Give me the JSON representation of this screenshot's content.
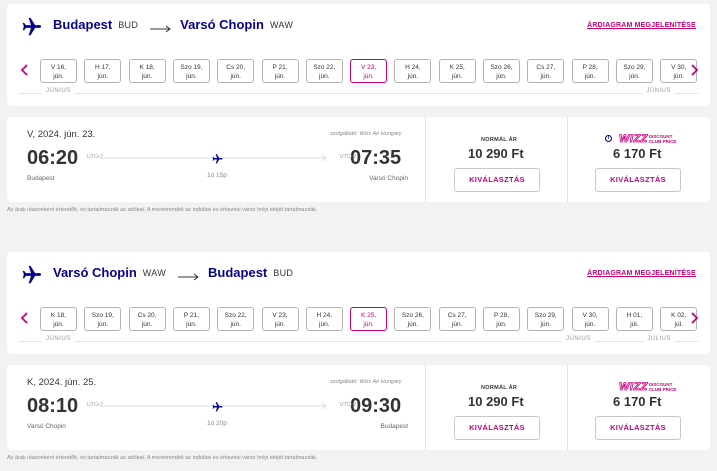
{
  "colors": {
    "brand": "#06038d",
    "accent": "#c6007e",
    "background": "#f2f2f2"
  },
  "sections": [
    {
      "route": {
        "from": "Budapest",
        "from_code": "BUD",
        "to": "Varsó Chopin",
        "to_code": "WAW"
      },
      "price_diagram": "ÁRDIAGRAM MEGJELENÍTÉSE",
      "dates": [
        {
          "day": "V 16,",
          "month": "jún."
        },
        {
          "day": "H 17,",
          "month": "jún."
        },
        {
          "day": "K 18,",
          "month": "jún."
        },
        {
          "day": "Szo 19,",
          "month": "jún."
        },
        {
          "day": "Cs 20,",
          "month": "jún."
        },
        {
          "day": "P 21,",
          "month": "jún."
        },
        {
          "day": "Szo 22,",
          "month": "jún."
        },
        {
          "day": "V 23,",
          "month": "jún."
        },
        {
          "day": "H 24,",
          "month": "jún."
        },
        {
          "day": "K 25,",
          "month": "jún."
        },
        {
          "day": "Szo 26,",
          "month": "jún."
        },
        {
          "day": "Cs 27,",
          "month": "jún."
        },
        {
          "day": "P 28,",
          "month": "jún."
        },
        {
          "day": "Szo 29,",
          "month": "jún."
        },
        {
          "day": "V 30,",
          "month": "jún."
        }
      ],
      "selected_index": 7,
      "months": [
        "JÚNIUS",
        "JÚNIUS"
      ],
      "flight": {
        "date": "V, 2024. jún. 23.",
        "operator": "szolgáltató: Wizz Air Hungary",
        "dep_time": "06:20",
        "dep_tz": "UTC+2",
        "arr_time": "07:35",
        "arr_tz": "UTC+2",
        "duration": "1ó 15p",
        "dep_city": "Budapest",
        "arr_city": "Varsó Chopin",
        "normal_label": "NORMÁL ÁR",
        "normal_price": "10 290 Ft",
        "club_price": "6 170 Ft",
        "club_wizz": "WIZZ",
        "club_text_1": "DISCOUNT",
        "club_text_2": "CLUB PRICE",
        "select_label": "KIVÁLASZTÁS"
      },
      "note": "Az árak utasonként értendők, és tartalmazzák az adókat. A menetrendek az indulási és érkezési város helyi idejét tartalmazzák."
    },
    {
      "route": {
        "from": "Varsó Chopin",
        "from_code": "WAW",
        "to": "Budapest",
        "to_code": "BUD"
      },
      "price_diagram": "ÁRDIAGRAM MEGJELENÍTÉSE",
      "dates": [
        {
          "day": "K 18,",
          "month": "jún."
        },
        {
          "day": "Szo 19,",
          "month": "jún."
        },
        {
          "day": "Cs 20,",
          "month": "jún."
        },
        {
          "day": "P 21,",
          "month": "jún."
        },
        {
          "day": "Szo 22,",
          "month": "jún."
        },
        {
          "day": "V 23,",
          "month": "jún."
        },
        {
          "day": "H 24,",
          "month": "jún."
        },
        {
          "day": "K 25,",
          "month": "jún."
        },
        {
          "day": "Szo 26,",
          "month": "jún."
        },
        {
          "day": "Cs 27,",
          "month": "jún."
        },
        {
          "day": "P 28,",
          "month": "jún."
        },
        {
          "day": "Szo 29,",
          "month": "jún."
        },
        {
          "day": "V 30,",
          "month": "jún."
        },
        {
          "day": "H 01,",
          "month": "júl."
        },
        {
          "day": "K 02,",
          "month": "júl."
        }
      ],
      "selected_index": 7,
      "months": [
        "JÚNIUS",
        "JÚNIUS",
        "JÚLIUS"
      ],
      "flight": {
        "date": "K, 2024. jún. 25.",
        "operator": "szolgáltató: Wizz Air Hungary",
        "dep_time": "08:10",
        "dep_tz": "UTC+2",
        "arr_time": "09:30",
        "arr_tz": "UTC+2",
        "duration": "1ó 20p",
        "dep_city": "Varsó Chopin",
        "arr_city": "Budapest",
        "normal_label": "NORMÁL ÁR",
        "normal_price": "10 290 Ft",
        "club_price": "6 170 Ft",
        "club_wizz": "WIZZ",
        "club_text_1": "DISCOUNT",
        "club_text_2": "CLUB PRICE",
        "select_label": "KIVÁLASZTÁS"
      },
      "note": "Az árak utasonként értendők, és tartalmazzák az adókat. A menetrendek az indulási és érkezési város helyi idejét tartalmazzák."
    }
  ]
}
